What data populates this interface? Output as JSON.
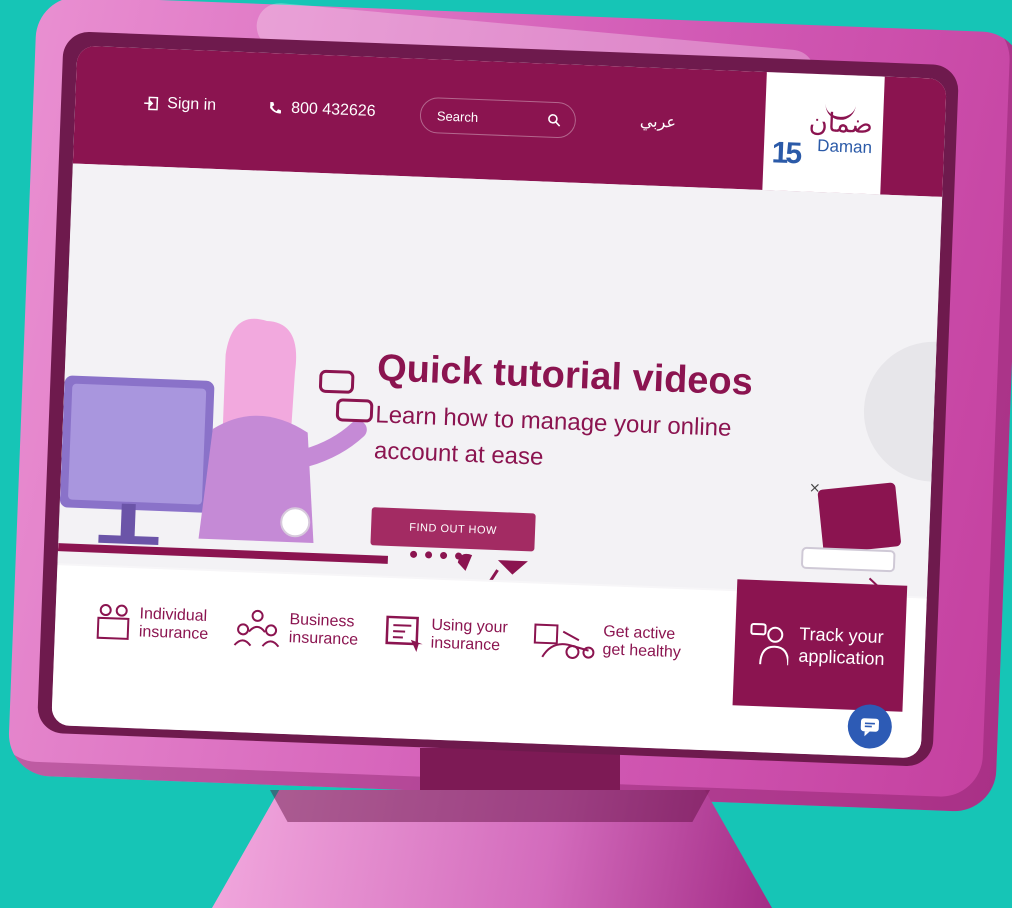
{
  "topbar": {
    "signin_label": "Sign in",
    "phone": "800 432626",
    "search_placeholder": "Search",
    "language_label": "عربي"
  },
  "logo": {
    "arabic": "ضمان",
    "english": "Daman",
    "anniversary": "15"
  },
  "hero": {
    "title": "Quick tutorial videos",
    "subtitle": "Learn how to manage your online account at ease",
    "cta_label": "FIND OUT HOW"
  },
  "tiles": [
    {
      "line1": "Individual",
      "line2": "insurance",
      "icon": "family-icon"
    },
    {
      "line1": "Business",
      "line2": "insurance",
      "icon": "group-icon"
    },
    {
      "line1": "Using your",
      "line2": "insurance",
      "icon": "card-click-icon"
    },
    {
      "line1": "Get active",
      "line2": "get healthy",
      "icon": "fitness-icon"
    },
    {
      "line1": "Track your",
      "line2": "application",
      "icon": "person-track-icon"
    }
  ],
  "colors": {
    "brand": "#8b1450",
    "background": "#16c5b6",
    "monitor": "#d35db7",
    "chat": "#2d5bb5"
  }
}
